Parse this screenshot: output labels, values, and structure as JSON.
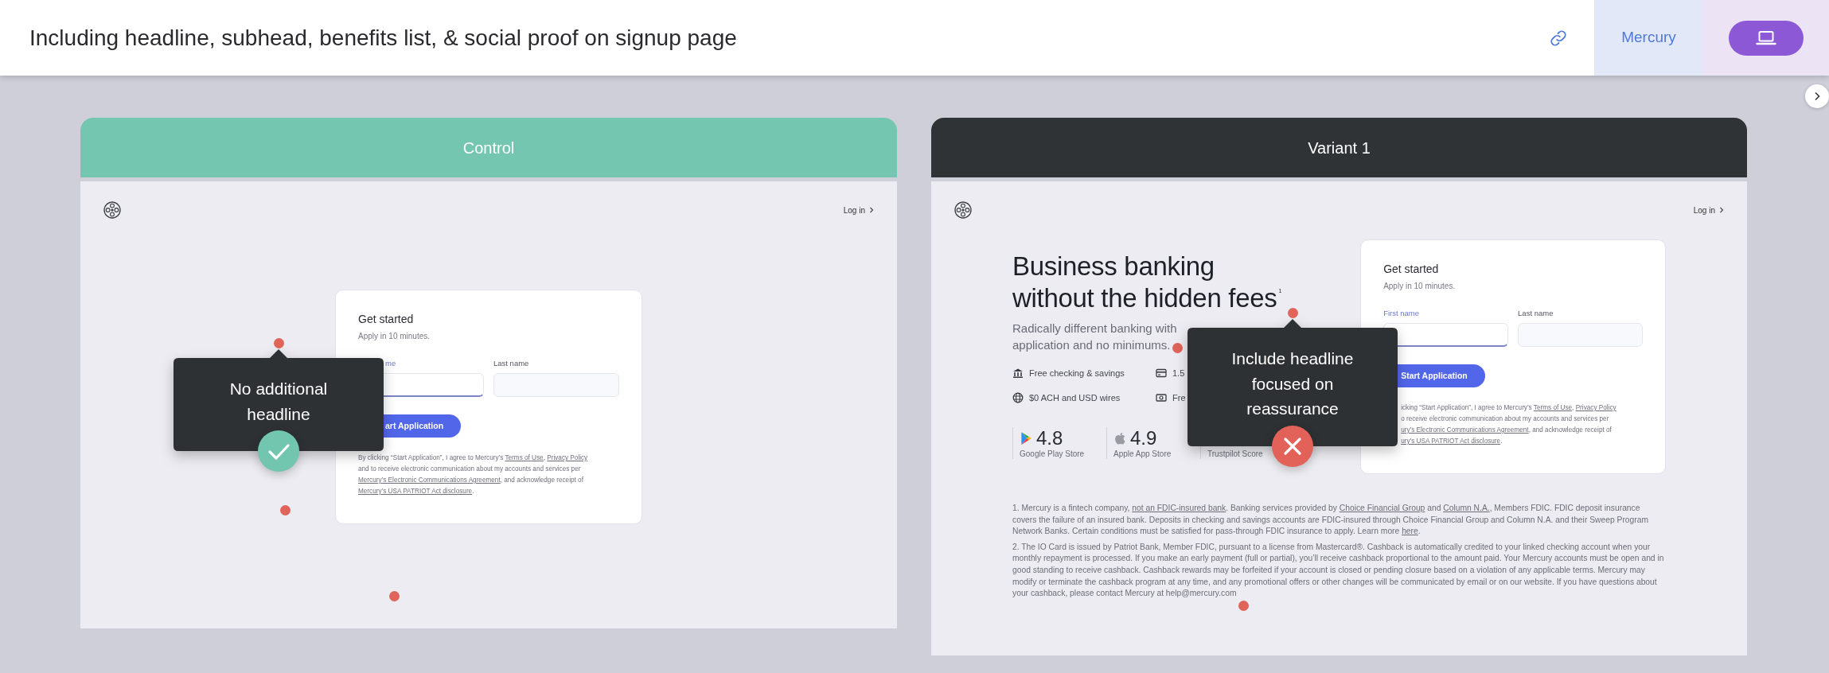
{
  "header": {
    "title": "Including headline, subhead, benefits list, & social proof on signup page",
    "company": "Mercury"
  },
  "panels": [
    {
      "title": "Control",
      "kind": "control",
      "page": {
        "login": "Log in",
        "form": {
          "title": "Get started",
          "subtitle": "Apply in 10 minutes.",
          "fields": [
            {
              "label": "me",
              "focused": true
            },
            {
              "label": "Last name",
              "focused": false
            }
          ],
          "button": "art Application",
          "legal_lines": [
            [
              {
                "kind": "text",
                "text": "By clicking “Start Application”, I agree to Mercury’s "
              },
              {
                "kind": "link",
                "text": "Terms of Use"
              },
              {
                "kind": "text",
                "text": ", "
              },
              {
                "kind": "link",
                "text": "Privacy Policy"
              }
            ],
            [
              {
                "kind": "text",
                "text": "and to receive electronic communication about my accounts and services per"
              }
            ],
            [
              {
                "kind": "link",
                "text": "Mercury’s Electronic Communications Agreement"
              },
              {
                "kind": "text",
                "text": ", and acknowledge receipt of"
              }
            ],
            [
              {
                "kind": "link",
                "text": "Mercury’s USA PATRIOT Act disclosure"
              },
              {
                "kind": "text",
                "text": "."
              }
            ]
          ]
        }
      },
      "annotation": {
        "text": "No additional headline",
        "approved": true
      }
    },
    {
      "title": "Variant 1",
      "kind": "variant",
      "page": {
        "login": "Log in",
        "hero": {
          "headline_lines": [
            "Business banking",
            "without the hidden fees$^{1}$"
          ],
          "subhead_lines": [
            "Radically different banking with",
            "application and no minimums."
          ],
          "benefits": [
            {
              "text": "Free checking & savings"
            },
            {
              "text": "1.5"
            },
            {
              "text": "$0 ACH and USD wires"
            },
            {
              "text": "Fre"
            }
          ],
          "ratings": [
            {
              "score": "4.8",
              "source": "Google Play Store"
            },
            {
              "score": "4.9",
              "source": "Apple App Store"
            },
            {
              "source": "Trustpilot Score"
            }
          ]
        },
        "form": {
          "title": "Get started",
          "subtitle": "Apply in 10 minutes.",
          "fields": [
            {
              "label": "First name",
              "focused": true
            },
            {
              "label": "Last name",
              "focused": false
            }
          ],
          "button": "Start Application",
          "legal_lines": [
            [
              {
                "kind": "text",
                "text": "icking “Start Application”, I agree to Mercury’s "
              },
              {
                "kind": "link",
                "text": "Terms of Use"
              },
              {
                "kind": "text",
                "text": ", "
              },
              {
                "kind": "link",
                "text": "Privacy Policy"
              }
            ],
            [
              {
                "kind": "text",
                "text": "o receive electronic communication about my accounts and services per"
              }
            ],
            [
              {
                "kind": "link",
                "text": "ury’s Electronic Communications Agreement"
              },
              {
                "kind": "text",
                "text": ", and acknowledge receipt of"
              }
            ],
            [
              {
                "kind": "link",
                "text": "ury’s USA PATRIOT Act disclosure"
              },
              {
                "kind": "text",
                "text": "."
              }
            ]
          ]
        },
        "footnotes": [
          [
            {
              "kind": "text",
              "text": "1. Mercury is a fintech company, "
            },
            {
              "kind": "link",
              "text": "not an FDIC-insured bank"
            },
            {
              "kind": "text",
              "text": ". Banking services provided by "
            },
            {
              "kind": "link",
              "text": "Choice Financial Group"
            },
            {
              "kind": "text",
              "text": " and "
            },
            {
              "kind": "link",
              "text": "Column N.A."
            },
            {
              "kind": "text",
              "text": ", Members FDIC. FDIC deposit insurance covers the failure of an insured bank. Deposits in checking and savings accounts are FDIC-insured through Choice Financial Group and Column N.A. and their Sweep Program Network Banks. Certain conditions must be satisfied for pass-through FDIC insurance to apply. Learn more "
            },
            {
              "kind": "link",
              "text": "here"
            },
            {
              "kind": "text",
              "text": "."
            }
          ],
          [
            {
              "kind": "text",
              "text": "2. The IO Card is issued by Patriot Bank, Member FDIC, pursuant to a license from Mastercard®. Cashback is automatically credited to your linked checking account when your monthly repayment is processed. If you make an early payment (full or partial), you’ll receive cashback proportional to the amount paid. Your Mercury accounts must be open and in good standing to receive cashback. Cashback rewards may be forfeited if your account is closed or pending closure based on a violation of any applicable terms. Mercury may modify or terminate the cashback program at any time, and any promotional offers or other changes will be communicated by email or on our website. If you have questions about your cashback, please contact Mercury at help@mercury.com"
            }
          ]
        ]
      },
      "annotation": {
        "text": "Include headline focused on reassurance",
        "approved": false
      }
    }
  ]
}
